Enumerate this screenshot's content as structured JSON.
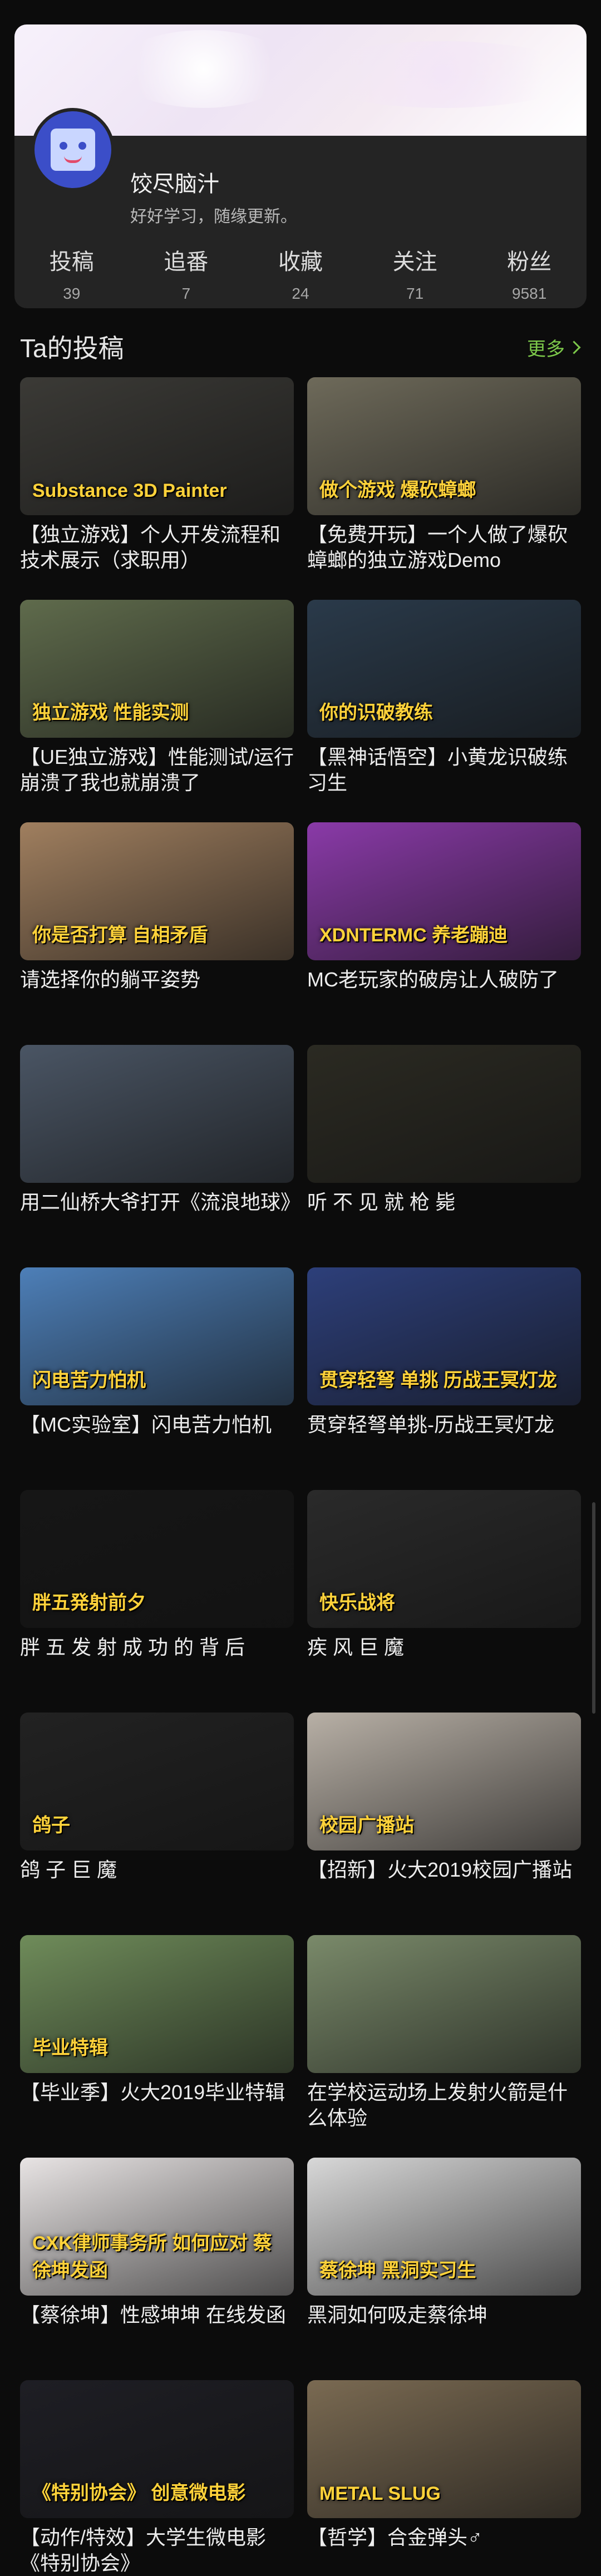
{
  "profile": {
    "name": "饺尽脑汁",
    "bio": "好好学习，随缘更新。",
    "stats": [
      {
        "label": "投稿",
        "value": "39"
      },
      {
        "label": "追番",
        "value": "7"
      },
      {
        "label": "收藏",
        "value": "24"
      },
      {
        "label": "关注",
        "value": "71"
      },
      {
        "label": "粉丝",
        "value": "9581"
      }
    ]
  },
  "section": {
    "title": "Ta的投稿",
    "more": "更多"
  },
  "videos": [
    {
      "title": "【独立游戏】个人开发流程和技术展示（求职用）",
      "overlay": "Substance 3D Painter",
      "bg": "#3b3a36"
    },
    {
      "title": "【免费开玩】一个人做了爆砍蟑螂的独立游戏Demo",
      "overlay": "做个游戏 爆砍蟑螂",
      "bg": "#6e6a5a"
    },
    {
      "title": "【UE独立游戏】性能测试/运行崩溃了我也就崩溃了",
      "overlay": "独立游戏 性能实测",
      "bg": "#5f6b4c"
    },
    {
      "title": "【黑神话悟空】小黄龙识破练习生",
      "overlay": "你的识破教练",
      "bg": "#2a3a4a"
    },
    {
      "title": "请选择你的躺平姿势",
      "overlay": "你是否打算 自相矛盾",
      "bg": "#a07f5f"
    },
    {
      "title": "MC老玩家的破房让人破防了",
      "overlay": "XDNTERMC 养老蹦迪",
      "bg": "#8a3aa8"
    },
    {
      "title": "用二仙桥大爷打开《流浪地球》",
      "overlay": "",
      "bg": "#4a5564"
    },
    {
      "title": "听 不 见 就 枪 毙",
      "overlay": "",
      "bg": "#2b2a22"
    },
    {
      "title": "【MC实验室】闪电苦力怕机",
      "overlay": "闪电苦力怕机",
      "bg": "#4d7fb8"
    },
    {
      "title": "贯穿轻弩单挑-历战王冥灯龙",
      "overlay": "贯穿轻弩 单挑 历战王冥灯龙",
      "bg": "#2d3f7a"
    },
    {
      "title": "胖 五 发 射 成 功 的 背 后",
      "overlay": "胖五発射前夕",
      "bg": "#161616"
    },
    {
      "title": "疾 风 巨 魔",
      "overlay": "快乐战将",
      "bg": "#2a2a2a"
    },
    {
      "title": "鸽 子 巨 魔",
      "overlay": "鸽子",
      "bg": "#222222"
    },
    {
      "title": "【招新】火大2019校园广播站",
      "overlay": "校园广播站",
      "bg": "#b8b0a6"
    },
    {
      "title": "【毕业季】火大2019毕业特辑",
      "overlay": "毕业特辑",
      "bg": "#6f8c5a"
    },
    {
      "title": "在学校运动场上发射火箭是什么体验",
      "overlay": "",
      "bg": "#7a8a6a"
    },
    {
      "title": "【蔡徐坤】性感坤坤 在线发函",
      "overlay": "CXK律师事务所 如何应对 蔡徐坤发函",
      "bg": "#e8e4e4"
    },
    {
      "title": "黑洞如何吸走蔡徐坤",
      "overlay": "蔡徐坤 黑洞实习生",
      "bg": "#d8d8d8"
    },
    {
      "title": "【动作/特效】大学生微电影《特别协会》",
      "overlay": "《特别协会》 创意微电影",
      "bg": "#1e1e24"
    },
    {
      "title": "【哲学】合金弹头♂",
      "overlay": "METAL SLUG",
      "bg": "#7a6a52"
    }
  ],
  "colors": {
    "accent_green": "#7cc84a",
    "background": "#0c0c0c",
    "card": "#242424"
  }
}
